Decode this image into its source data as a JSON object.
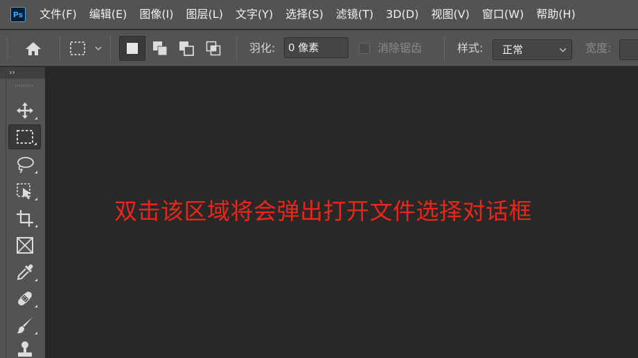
{
  "app": {
    "logo_text": "Ps",
    "accent": "#31a8ff"
  },
  "menu": [
    "文件(F)",
    "编辑(E)",
    "图像(I)",
    "图层(L)",
    "文字(Y)",
    "选择(S)",
    "滤镜(T)",
    "3D(D)",
    "视图(V)",
    "窗口(W)",
    "帮助(H)"
  ],
  "options": {
    "feather_label": "羽化:",
    "feather_value": "0 像素",
    "antialias_label": "消除锯齿",
    "style_label": "样式:",
    "style_value": "正常",
    "width_label": "宽度:"
  },
  "panel": {
    "collapse_glyph": "››"
  },
  "tools": [
    "move-tool",
    "rectangular-marquee-tool",
    "lasso-tool",
    "object-selection-tool",
    "crop-tool",
    "frame-tool",
    "eyedropper-tool",
    "spot-healing-brush-tool",
    "brush-tool",
    "clone-stamp-tool"
  ],
  "canvas": {
    "hint": "双击该区域将会弹出打开文件选择对话框",
    "hint_color": "#ea2619"
  }
}
